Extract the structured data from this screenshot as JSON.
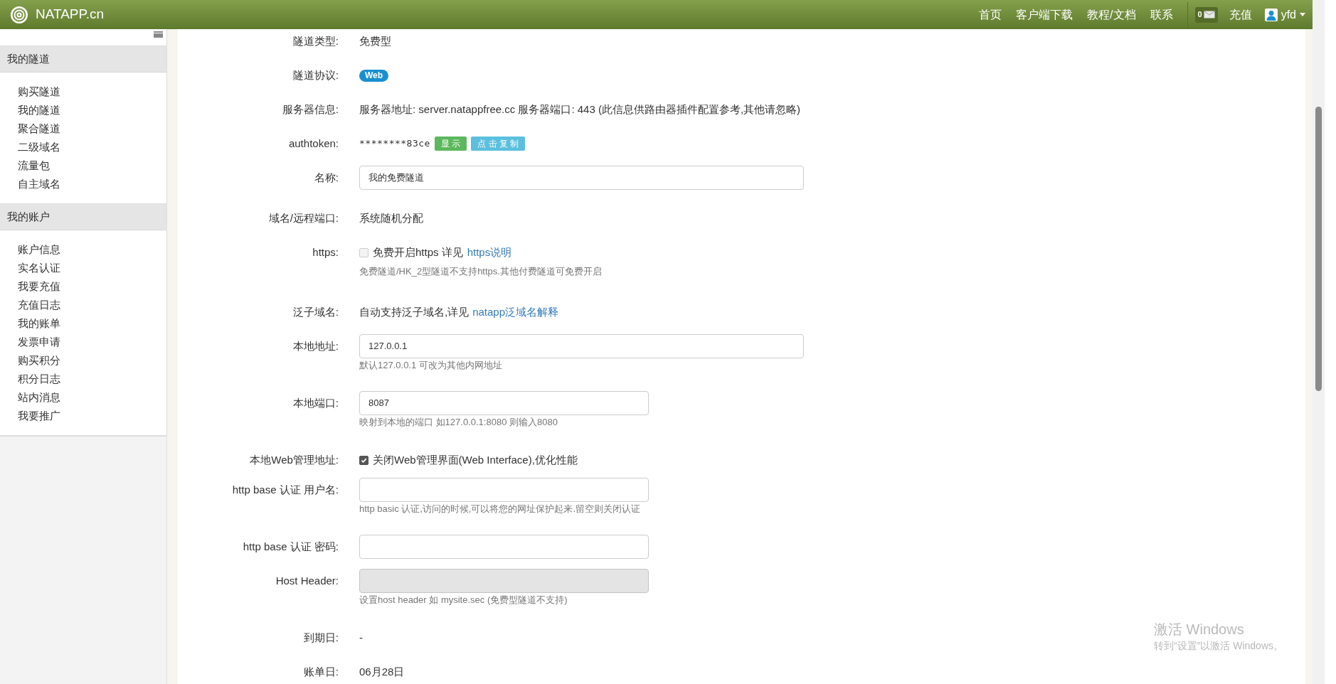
{
  "topbar": {
    "brand": "NATAPP.cn",
    "nav": [
      {
        "label": "首页"
      },
      {
        "label": "客户端下载"
      },
      {
        "label": "教程/文档"
      },
      {
        "label": "联系"
      }
    ],
    "messages_count": "0",
    "recharge": "充值",
    "user": "yfd"
  },
  "sidebar": {
    "sections": [
      {
        "title": "我的隧道",
        "items": [
          "购买隧道",
          "我的隧道",
          "聚合隧道",
          "二级域名",
          "流量包",
          "自主域名"
        ]
      },
      {
        "title": "我的账户",
        "items": [
          "账户信息",
          "实名认证",
          "我要充值",
          "充值日志",
          "我的账单",
          "发票申请",
          "购买积分",
          "积分日志",
          "站内消息",
          "我要推广"
        ]
      }
    ]
  },
  "form": {
    "rows": [
      {
        "kind": "text",
        "label": "隧道类型:",
        "value": "免费型"
      },
      {
        "kind": "badge",
        "label": "隧道协议:",
        "value": "Web"
      },
      {
        "kind": "text",
        "label": "服务器信息:",
        "value": "服务器地址: server.natappfree.cc 服务器端口: 443 (此信息供路由器插件配置参考,其他请忽略)"
      },
      {
        "kind": "token",
        "label": "authtoken:",
        "value": "********83ce",
        "buttons": [
          {
            "label": "显 示",
            "kind": "success"
          },
          {
            "label": "点 击 复 制",
            "kind": "info"
          }
        ]
      },
      {
        "kind": "wideinput",
        "label": "名称:",
        "value": "我的免费隧道",
        "disabled": false
      },
      {
        "kind": "text",
        "label": "域名/远程端口:",
        "value": "系统随机分配"
      },
      {
        "kind": "checkbox",
        "label": "https:",
        "checked": false,
        "disabled": true,
        "text": "免费开启https 详见",
        "link": "https说明",
        "hint": "免费隧道/HK_2型隧道不支持https.其他付费隧道可免费开启"
      },
      {
        "kind": "link_text",
        "label": "泛子域名:",
        "value": "自动支持泛子域名,详见",
        "link": "natapp泛域名解释"
      },
      {
        "kind": "wideinput",
        "label": "本地地址:",
        "value": "127.0.0.1",
        "disabled": false,
        "hint": "默认127.0.0.1 可改为其他内网地址"
      },
      {
        "kind": "input",
        "label": "本地端口:",
        "value": "8087",
        "disabled": false,
        "hint": "映射到本地的端口 如127.0.0.1:8080 则输入8080"
      },
      {
        "kind": "checkbox",
        "label": "本地Web管理地址:",
        "checked": true,
        "text": "关闭Web管理界面(Web Interface),优化性能"
      },
      {
        "kind": "input",
        "label": "http base 认证 用户名:",
        "disabled": false,
        "hint": "http basic 认证,访问的时候,可以将您的网址保护起来.留空则关闭认证"
      },
      {
        "kind": "input",
        "label": "http base 认证 密码:",
        "disabled": false
      },
      {
        "kind": "input",
        "label": "Host Header:",
        "disabled": true,
        "hint": "设置host header 如 mysite.sec (免费型隧道不支持)"
      },
      {
        "kind": "text",
        "label": "到期日:",
        "value": "-"
      },
      {
        "kind": "text",
        "label": "账单日:",
        "value": "06月28日"
      }
    ]
  },
  "os_notice": {
    "title": "激活 Windows",
    "text": "转到“设置”以激活 Windows。"
  }
}
